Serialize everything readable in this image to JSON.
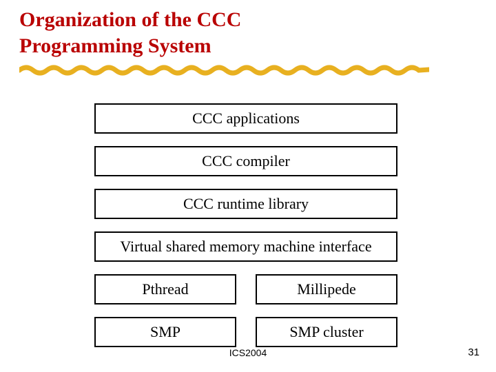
{
  "title": {
    "line1": "Organization of the CCC",
    "line2": "Programming System"
  },
  "layers": {
    "applications": "CCC applications",
    "compiler": "CCC compiler",
    "runtime": "CCC runtime library",
    "vsm": "Virtual shared memory machine interface",
    "thread_left": "Pthread",
    "thread_right": "Millipede",
    "hw_left": "SMP",
    "hw_right": "SMP cluster"
  },
  "footer": {
    "center": "ICS2004",
    "page": "31"
  },
  "colors": {
    "title": "#b90000",
    "wave": "#e8b020"
  }
}
